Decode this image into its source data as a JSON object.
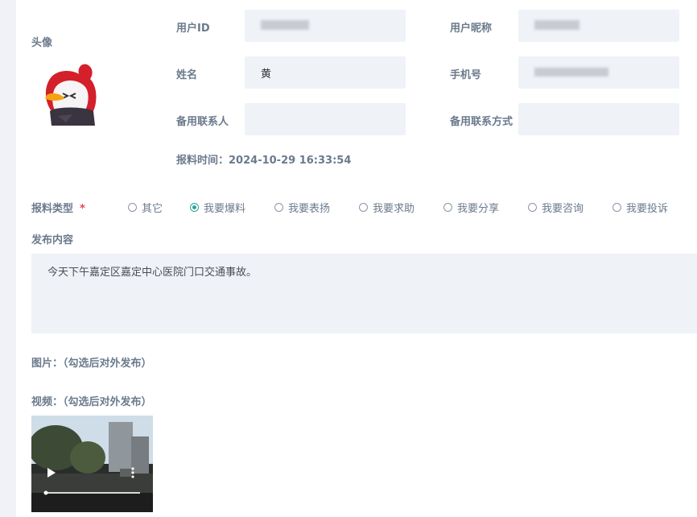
{
  "profile": {
    "avatar_label": "头像",
    "user_id_label": "用户ID",
    "nickname_label": "用户昵称",
    "name_label": "姓名",
    "name_value": "黄",
    "phone_label": "手机号",
    "backup_contact_label": "备用联系人",
    "backup_method_label": "备用联系方式",
    "report_time_label": "报料时间：",
    "report_time_value": "2024-10-29 16:33:54"
  },
  "report_type": {
    "label": "报料类型",
    "required_mark": "*",
    "options": [
      "其它",
      "我要爆料",
      "我要表扬",
      "我要求助",
      "我要分享",
      "我要咨询",
      "我要投诉"
    ],
    "selected": "我要爆料"
  },
  "content": {
    "label": "发布内容",
    "value": "今天下午嘉定区嘉定中心医院门口交通事故。"
  },
  "images": {
    "label": "图片：（勾选后对外发布）"
  },
  "videos": {
    "label": "视频：（勾选后对外发布）"
  },
  "colors": {
    "accent": "#26a69a",
    "required": "#e0474f",
    "field_bg": "#eff2f7"
  }
}
